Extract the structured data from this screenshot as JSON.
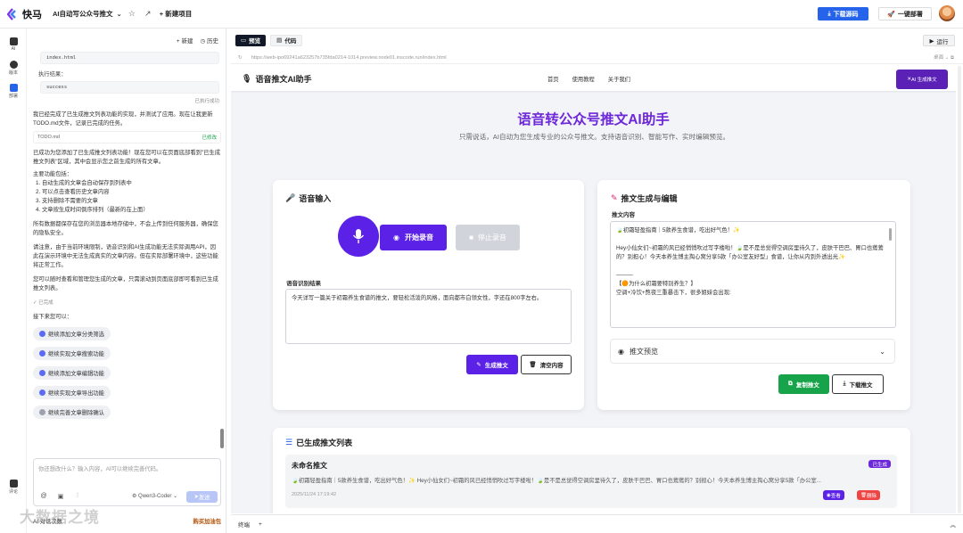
{
  "topbar": {
    "logo_text": "快马",
    "project_name": "AI自动写公众号推文",
    "new_project": "新建项目",
    "download_label": "下载源码",
    "deploy_label": "一键部署"
  },
  "rail": {
    "items": [
      {
        "label": "AI",
        "icon": "robot-icon"
      },
      {
        "label": "版本",
        "icon": "history-icon"
      },
      {
        "label": "部署",
        "icon": "deploy-icon"
      },
      {
        "label": "评论",
        "icon": "comment-icon"
      }
    ]
  },
  "chat": {
    "new_label": "新建",
    "history_label": "历史",
    "code_file": "index.html",
    "exec_result_label": "执行结果：",
    "exec_result_value": "success",
    "executed_label": "已执行成功",
    "msg1": "我已经完成了已生成推文列表功能的实现，并测试了应用。现在让我更新TODO.md文件，记录已完成的任务。",
    "todo_file": "TODO.md",
    "todo_status": "已修改",
    "msg2": "已成功为您添加了已生成推文列表功能！现在您可以在页面底部看到\"已生成推文列表\"区域，其中会显示您之前生成的所有文章。",
    "features_title": "主要功能包括：",
    "features": [
      "自动生成的文章会自动保存到列表中",
      "可以点击查看历史文章内容",
      "支持删除不需要的文章",
      "文章按生成时间倒序排列（最新的在上面）"
    ],
    "msg3": "所有数据都保存在您的浏览器本地存储中，不会上传到任何服务器，确保您的隐私安全。",
    "msg4": "请注意，由于当前环境限制，语音识别和AI生成功能无法实际调用API，因此在演示环境中无法生成真实的文章内容。但在实际部署环境中，这些功能将正常工作。",
    "msg5": "您可以随时查看和管理您生成的文章，只需滚动到页面底部即可看到已生成推文列表。",
    "done_label": "已完成",
    "next_label": "接下来您可以：",
    "suggestions": [
      "继续添加文章分类筛选",
      "继续实现文章搜索功能",
      "继续添加文章编辑功能",
      "继续实现文章导出功能",
      "继续完善文章删除确认"
    ],
    "input_placeholder": "你还想改什么？输入内容，AI可以继续完善代码。",
    "model_label": "Qwen3-Coder",
    "send_label": "发送",
    "footer_left": "AI 对话次数",
    "footer_right": "购买加油包",
    "watermark": "大数据之境"
  },
  "preview": {
    "tab_preview": "预览",
    "tab_code": "代码",
    "run_label": "运行",
    "url": "https://web-ipo69241a623257b735fda0214-1014.preview.node01.inscode.run/index.html",
    "device_label": "桌面",
    "bottom_terminal": "终端"
  },
  "app": {
    "brand": "语音推文AI助手",
    "nav": [
      "首页",
      "使用教程",
      "关于我们"
    ],
    "float_button": "AI 生成推文",
    "hero_title": "语音转公众号推文AI助手",
    "hero_sub": "只需说话，AI自动为您生成专业的公众号推文。支持语音识别、智能写作、实时编辑预览。",
    "voice_card_title": "语音输入",
    "start_record": "开始录音",
    "stop_record": "停止录音",
    "recog_label": "语音识别结果",
    "recog_text": "今天详写一篇关于初霜养生食谱的推文，要轻松活泼的风格，面向都市白领女性，字还在800字左右。",
    "gen_button": "生成推文",
    "clear_button": "清空内容",
    "edit_card_title": "推文生成与编辑",
    "content_label": "推文内容",
    "content_lines": [
      "🍃初霜轻盈指南｜5款养生食谱，吃出好气色！✨",
      "",
      "Hey小仙女们~初霜的风已经悄悄吹过写字楼啦！🍃是不是总觉得空调房里待久了，皮肤干巴巴、胃口也蔫蔫的？别担心！今天本养生博主掏心窝分享5款「办公室友好型」食谱，让你从内到外透出光✨",
      "",
      "———",
      "【🟠为什么初霜要特别养生？】",
      "空调+冷饮+熬夜三重暴击下，很多姐妹会出现:"
    ],
    "preview_toggle": "推文预览",
    "copy_button": "复制推文",
    "download_button": "下载推文",
    "list_title": "已生成推文列表",
    "list_items": [
      {
        "title": "未命名推文",
        "tag": "已生成",
        "excerpt": "🍃初霜轻盈指南｜5款养生食谱，吃出好气色！✨ Hey小仙女们~初霜的风已经悄悄吹过写字楼啦！🍃是不是总觉得空调房里待久了，皮肤干巴巴、胃口也蔫蔫的？别担心！今天本养生博主掏心窝分享5款「办公室...",
        "date": "2025/11/24 17:19:42",
        "view_label": "查看",
        "delete_label": "删除"
      }
    ]
  },
  "colors": {
    "accent": "#5b21e6",
    "brand_purple": "#6d28d9",
    "primary_blue": "#2563eb",
    "success_green": "#16a34a",
    "danger_red": "#ef4444"
  }
}
